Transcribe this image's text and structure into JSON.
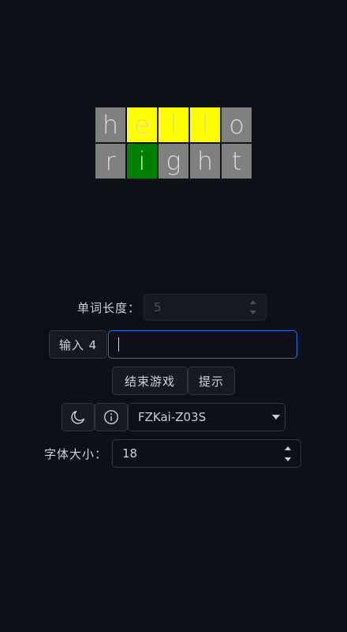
{
  "board": {
    "rows": [
      [
        {
          "letter": "h",
          "state": "gray"
        },
        {
          "letter": "e",
          "state": "yellow"
        },
        {
          "letter": "l",
          "state": "yellow"
        },
        {
          "letter": "l",
          "state": "yellow"
        },
        {
          "letter": "o",
          "state": "gray"
        }
      ],
      [
        {
          "letter": "r",
          "state": "gray"
        },
        {
          "letter": "i",
          "state": "green"
        },
        {
          "letter": "g",
          "state": "gray"
        },
        {
          "letter": "h",
          "state": "gray"
        },
        {
          "letter": "t",
          "state": "gray"
        }
      ]
    ],
    "colors": {
      "gray": "#808080",
      "yellow": "#ffff00",
      "green": "#007f00"
    }
  },
  "word_length": {
    "label": "单词长度：",
    "value": "5"
  },
  "guess": {
    "button_label": "输入 4",
    "value": ""
  },
  "actions": {
    "end_game": "结束游戏",
    "hint": "提示"
  },
  "toolbar": {
    "theme_icon": "moon-icon",
    "info_icon": "info-icon",
    "font_select": "FZKai-Z03S"
  },
  "font_size": {
    "label": "字体大小：",
    "value": "18"
  },
  "theme": {
    "background": "#0d1117",
    "accent": "#1f6feb"
  }
}
